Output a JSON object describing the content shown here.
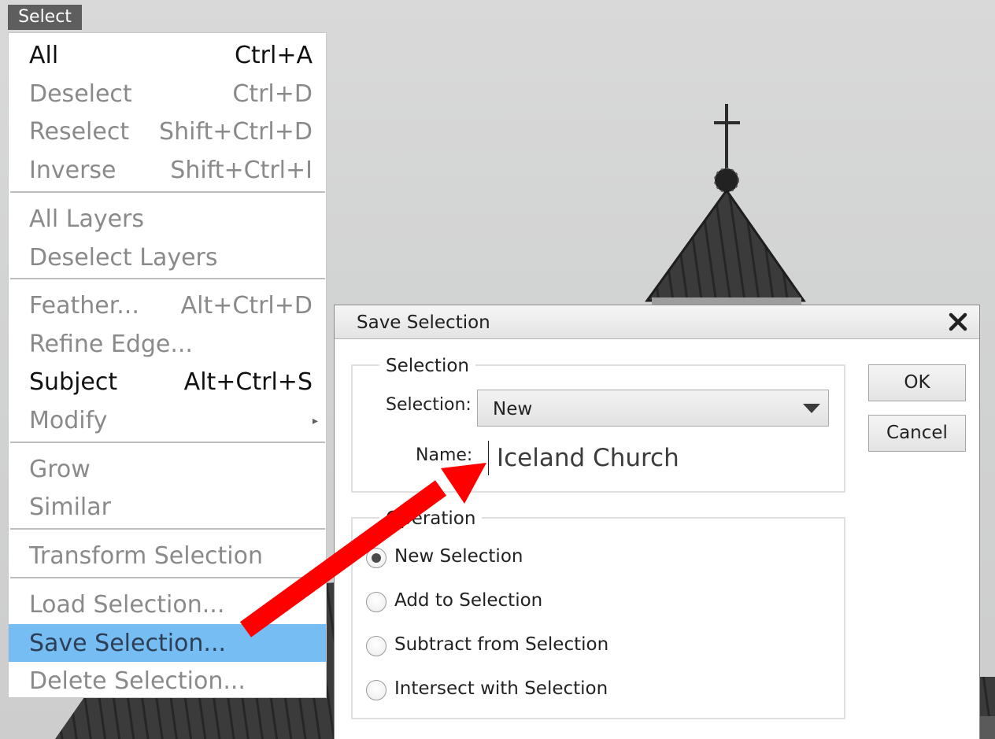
{
  "menubar": {
    "select_label": "Select"
  },
  "menu": {
    "items": [
      {
        "label": "All",
        "shortcut": "Ctrl+A",
        "enabled": true
      },
      {
        "label": "Deselect",
        "shortcut": "Ctrl+D",
        "enabled": false
      },
      {
        "label": "Reselect",
        "shortcut": "Shift+Ctrl+D",
        "enabled": false
      },
      {
        "label": "Inverse",
        "shortcut": "Shift+Ctrl+I",
        "enabled": false
      },
      {
        "label": "All Layers",
        "shortcut": "",
        "enabled": false
      },
      {
        "label": "Deselect Layers",
        "shortcut": "",
        "enabled": false
      },
      {
        "label": "Feather...",
        "shortcut": "Alt+Ctrl+D",
        "enabled": false
      },
      {
        "label": "Refine Edge...",
        "shortcut": "",
        "enabled": false
      },
      {
        "label": "Subject",
        "shortcut": "Alt+Ctrl+S",
        "enabled": true
      },
      {
        "label": "Modify",
        "shortcut": "",
        "enabled": false,
        "submenu": true
      },
      {
        "label": "Grow",
        "shortcut": "",
        "enabled": false
      },
      {
        "label": "Similar",
        "shortcut": "",
        "enabled": false
      },
      {
        "label": "Transform Selection",
        "shortcut": "",
        "enabled": false
      },
      {
        "label": "Load Selection...",
        "shortcut": "",
        "enabled": false
      },
      {
        "label": "Save Selection...",
        "shortcut": "",
        "enabled": true,
        "highlighted": true
      },
      {
        "label": "Delete Selection...",
        "shortcut": "",
        "enabled": false
      }
    ]
  },
  "dialog": {
    "title": "Save Selection",
    "close_icon": "close-icon",
    "selection_group": {
      "title": "Selection",
      "selection_label": "Selection:",
      "selection_value": "New",
      "name_label": "Name:",
      "name_value": "Iceland Church"
    },
    "operation_group": {
      "title": "Operation",
      "options": [
        {
          "label": "New Selection",
          "checked": true
        },
        {
          "label": "Add to Selection",
          "checked": false
        },
        {
          "label": "Subtract from Selection",
          "checked": false
        },
        {
          "label": "Intersect with Selection",
          "checked": false
        }
      ]
    },
    "ok_label": "OK",
    "cancel_label": "Cancel"
  },
  "annotation": {
    "arrow_color": "#ff0000"
  },
  "colors": {
    "menu_highlight": "#75bdf2",
    "menubar_bg": "#5e5e5e",
    "sky": "#d3d3d3",
    "roof": "#3a3a3a"
  }
}
